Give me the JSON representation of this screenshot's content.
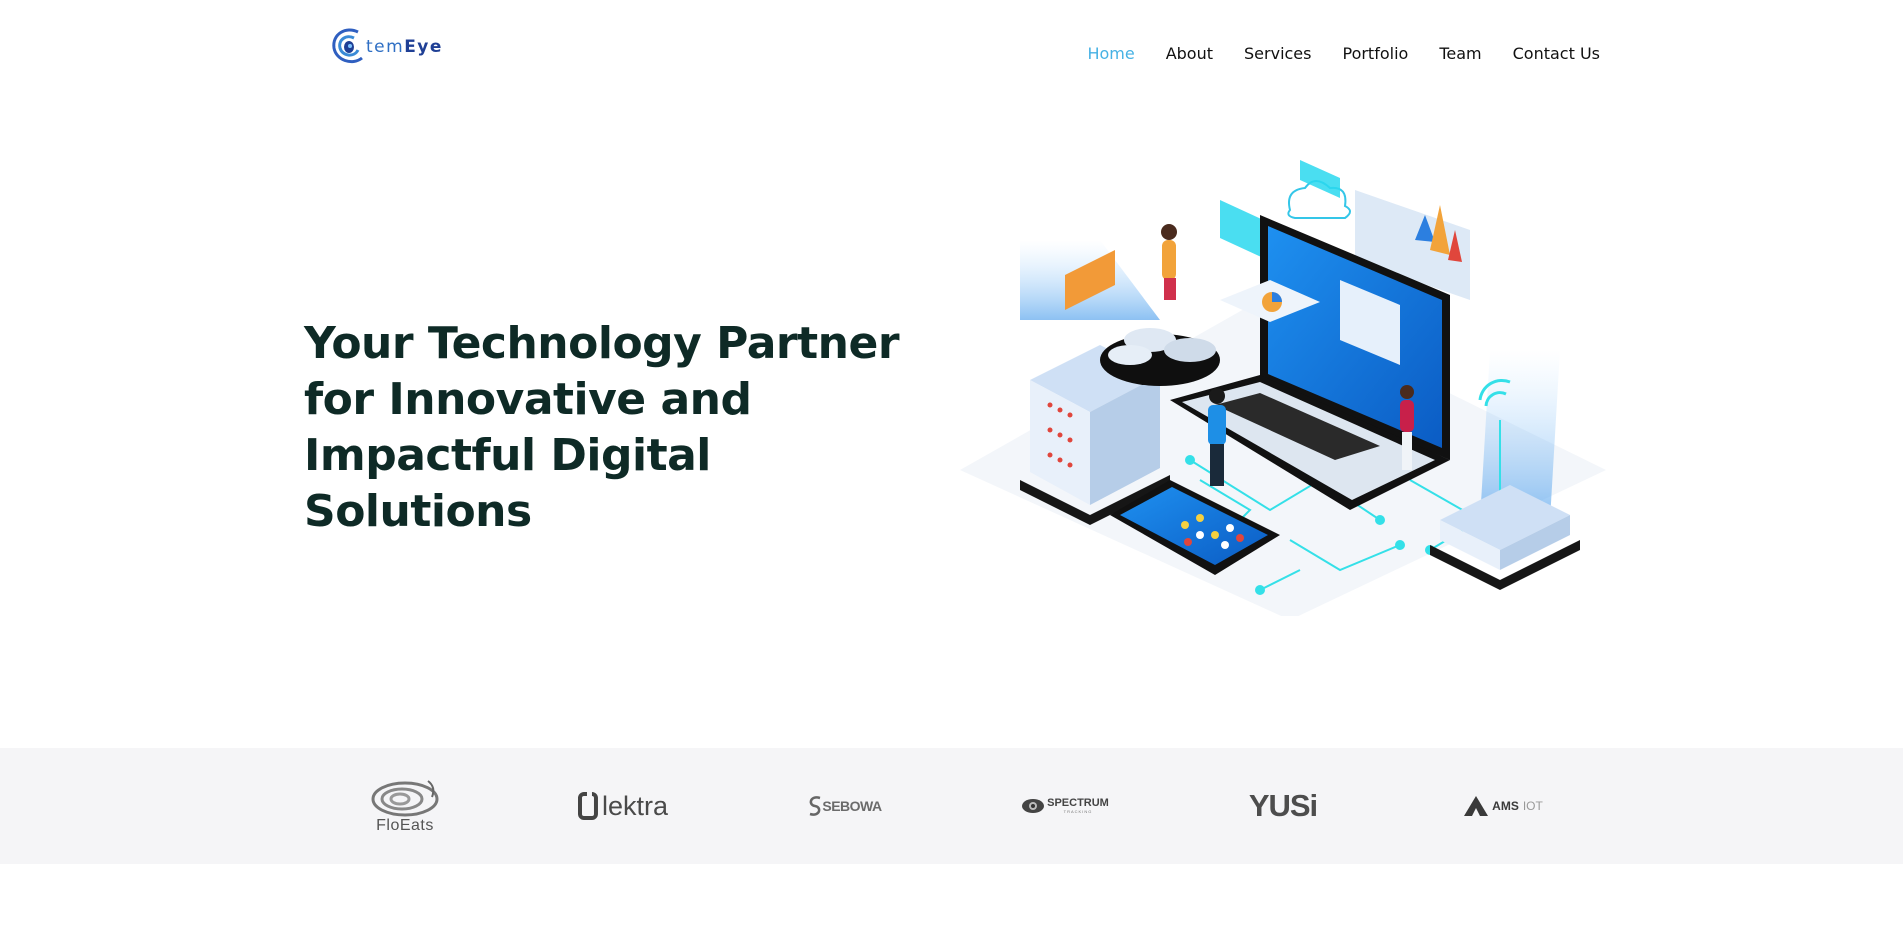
{
  "brand": {
    "name_prefix": "tem",
    "name_suffix": "Eye",
    "logo_icon": "swirl-eye-logo"
  },
  "nav": {
    "items": [
      {
        "label": "Home",
        "active": true
      },
      {
        "label": "About",
        "active": false
      },
      {
        "label": "Services",
        "active": false
      },
      {
        "label": "Portfolio",
        "active": false
      },
      {
        "label": "Team",
        "active": false
      },
      {
        "label": "Contact Us",
        "active": false
      }
    ]
  },
  "hero": {
    "title": "Your Technology Partner for Innovative and Impactful Digital Solutions",
    "illustration": "isometric-laptop-servers-illustration"
  },
  "clients": {
    "logos": [
      {
        "name": "FloEats",
        "icon": "spiral-logo"
      },
      {
        "name": "lektra",
        "icon": "e-bolt-logo"
      },
      {
        "name": "SEBOWA",
        "icon": "sebowa-logo"
      },
      {
        "name": "SPECTRUM",
        "sub": "TRACKING",
        "icon": "eye-logo"
      },
      {
        "name": "YUSi",
        "icon": "yusi-logo"
      },
      {
        "name": "AMS",
        "sub": "IOT",
        "icon": "triangle-logo"
      }
    ]
  },
  "colors": {
    "accent": "#47b2e4",
    "heading": "#0e2a26",
    "clients_bg": "#f5f5f7"
  }
}
